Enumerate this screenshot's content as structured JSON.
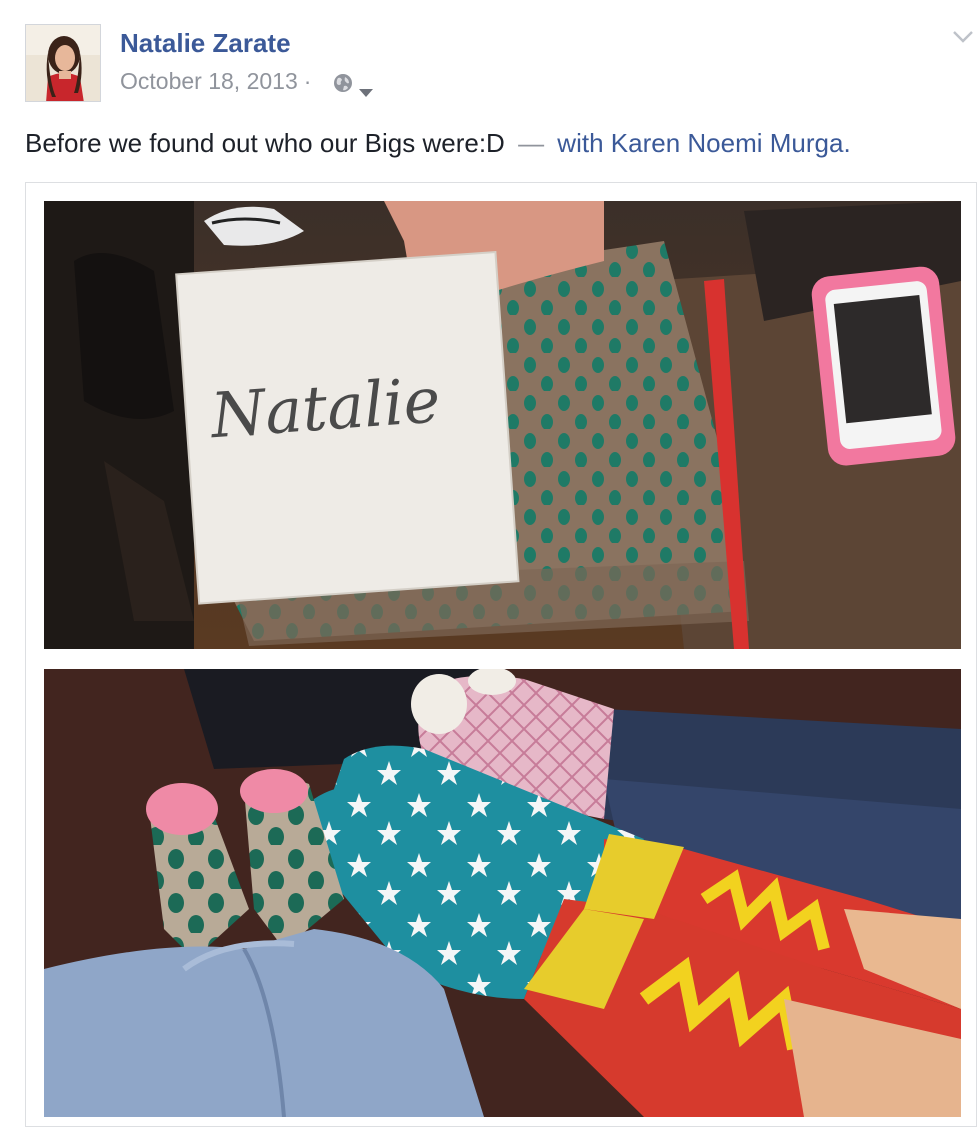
{
  "post": {
    "author": "Natalie Zarate",
    "date": "October 18, 2013",
    "separator": "·",
    "privacy_icon": "globe-icon",
    "privacy_dropdown_icon": "caret-down-icon",
    "options_icon": "chevron-down-icon",
    "status": {
      "text": "Before we found out who our Bigs were:D",
      "dash": "—",
      "with_label": "with",
      "tagged": "Karen Noemi Murga",
      "period": "."
    },
    "photos": [
      {
        "note_text": "Natalie"
      },
      {}
    ]
  },
  "colors": {
    "link": "#3b5998",
    "meta_text": "#90949c",
    "body_text": "#1d2129",
    "border": "#dddfe2"
  }
}
